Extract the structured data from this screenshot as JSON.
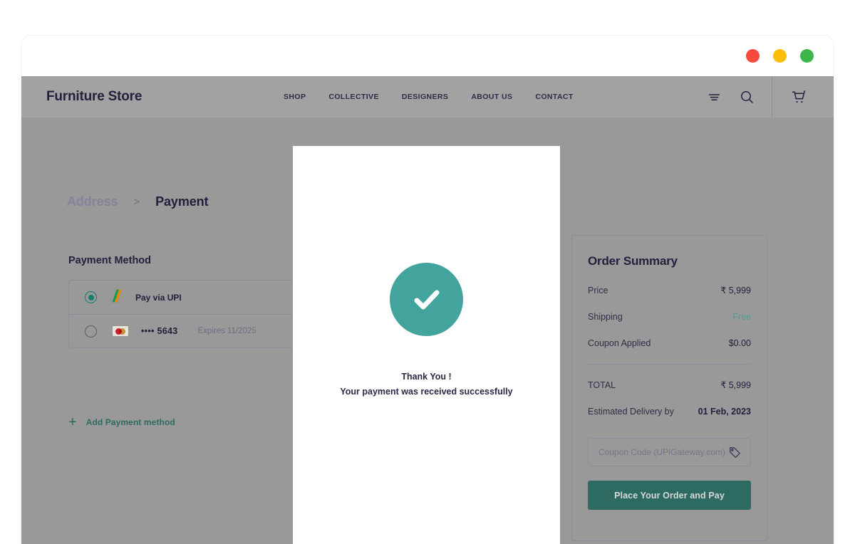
{
  "window": {
    "traffic_lights": [
      {
        "name": "close",
        "color": "#f8493d"
      },
      {
        "name": "minimize",
        "color": "#fcbe00"
      },
      {
        "name": "maximize",
        "color": "#3cb64a"
      }
    ]
  },
  "header": {
    "brand": "Furniture Store",
    "nav": [
      {
        "label": "SHOP"
      },
      {
        "label": "COLLECTIVE"
      },
      {
        "label": "DESIGNERS"
      },
      {
        "label": "ABOUT US"
      },
      {
        "label": "CONTACT"
      }
    ],
    "tools": {
      "menu_icon": "menu-lines-icon",
      "search_icon": "search-icon",
      "cart_icon": "shopping-cart-icon"
    }
  },
  "checkout": {
    "breadcrumb": {
      "step_1": "Address",
      "separator": ">",
      "step_2": "Payment"
    },
    "payment_method_title": "Payment Method",
    "methods": [
      {
        "selected": true,
        "icon": "upi-icon",
        "label": "Pay via UPI",
        "expires": ""
      },
      {
        "selected": false,
        "icon": "mastercard-icon",
        "label": "•••• 5643",
        "expires": "Expires 11/2025"
      }
    ],
    "add_payment_label": "Add Payment method",
    "add_payment_plus": "+"
  },
  "order_summary": {
    "title": "Order Summary",
    "rows": [
      {
        "label": "Price",
        "value": "₹ 5,999",
        "style": "normal"
      },
      {
        "label": "Shipping",
        "value": "Free",
        "style": "free"
      },
      {
        "label": "Coupon Applied",
        "value": "$0.00",
        "style": "normal"
      }
    ],
    "total": {
      "label": "TOTAL",
      "value": "₹ 5,999"
    },
    "delivery": {
      "label": "Estimated Delivery by",
      "value": "01 Feb, 2023"
    },
    "coupon": {
      "value": "",
      "placeholder": "Coupon Code (UPIGateway.com)",
      "icon": "tag-icon"
    },
    "place_order_label": "Place Your Order and Pay"
  },
  "modal": {
    "icon": "check-circle-icon",
    "title": "Thank You !",
    "subtitle": "Your payment was received successfully",
    "accent_color": "#43a49d"
  }
}
